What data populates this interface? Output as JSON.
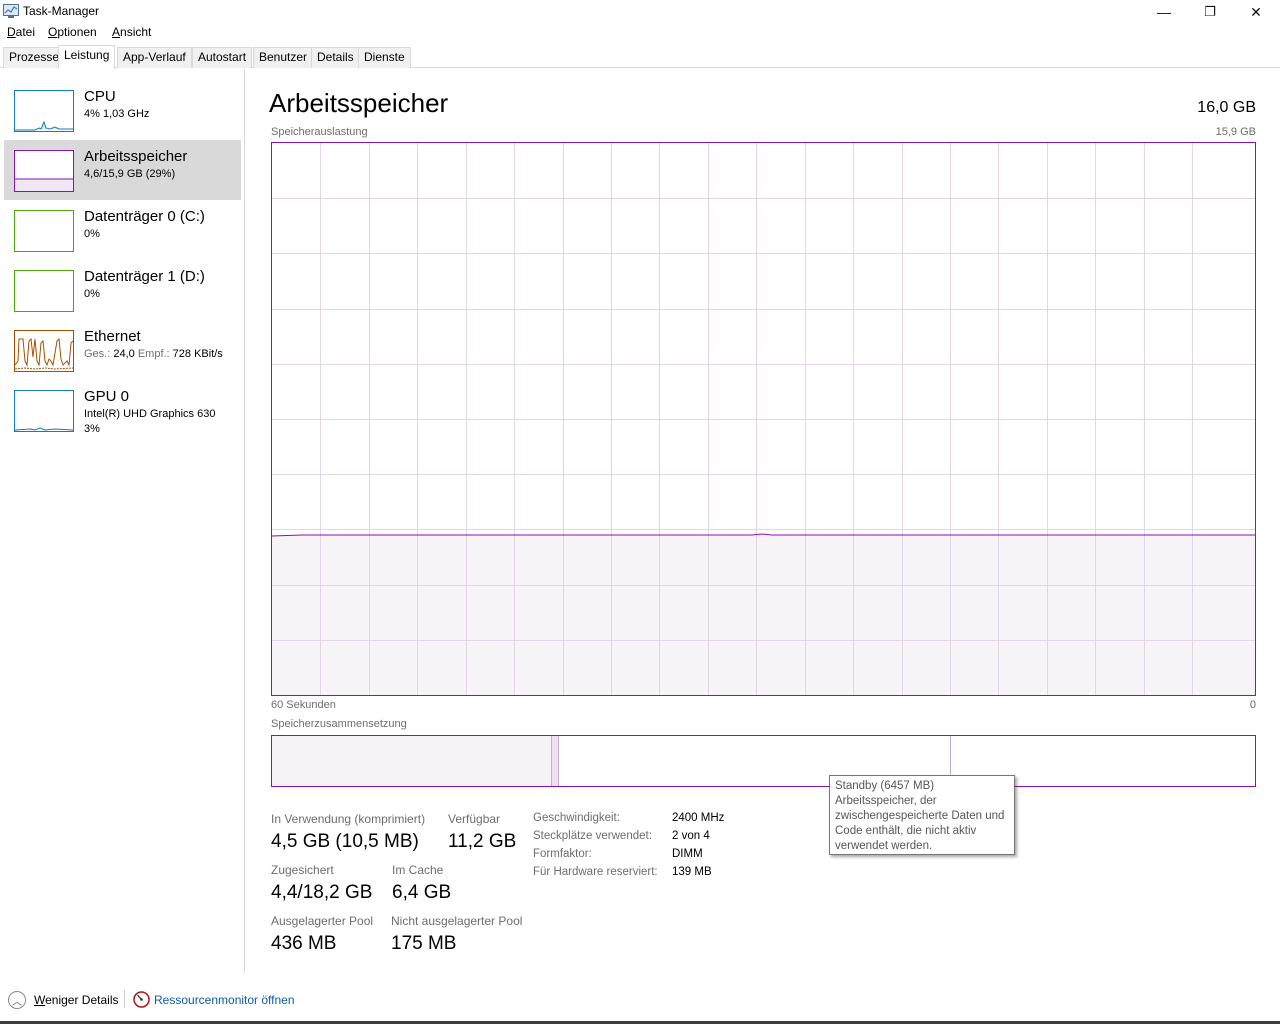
{
  "window": {
    "title": "Task-Manager",
    "minimize_glyph": "—",
    "restore_glyph": "❐",
    "close_glyph": "✕"
  },
  "menu": {
    "items": [
      {
        "accel": "D",
        "rest": "atei"
      },
      {
        "accel": "O",
        "rest": "ptionen"
      },
      {
        "accel": "A",
        "rest": "nsicht"
      }
    ]
  },
  "tabs": [
    "Prozesse",
    "Leistung",
    "App-Verlauf",
    "Autostart",
    "Benutzer",
    "Details",
    "Dienste"
  ],
  "active_tab": "Leistung",
  "sidebar": {
    "items": [
      {
        "name": "CPU",
        "sub": "4%  1,03 GHz",
        "color": "#117dbb",
        "icon": "cpu-graph"
      },
      {
        "name": "Arbeitsspeicher",
        "sub": "4,6/15,9 GB (29%)",
        "color": "#8b12ae",
        "icon": "memory-graph"
      },
      {
        "name": "Datenträger 0 (C:)",
        "sub": "0%",
        "color": "#4da60c",
        "icon": "disk-graph"
      },
      {
        "name": "Datenträger 1 (D:)",
        "sub": "0%",
        "color": "#4da60c",
        "icon": "disk-graph"
      },
      {
        "name": "Ethernet",
        "sub_label1": "Ges.: ",
        "sub_val1": "24,0",
        "sub_label2": " Empf.: ",
        "sub_val2": "728 KBit/s",
        "color": "#a74f01",
        "icon": "network-graph"
      },
      {
        "name": "GPU 0",
        "sub": "Intel(R) UHD Graphics 630",
        "sub2": "3%",
        "color": "#117dbb",
        "icon": "gpu-graph"
      }
    ]
  },
  "main": {
    "title": "Arbeitsspeicher",
    "total": "16,0 GB",
    "graph_label": "Speicherauslastung",
    "graph_max": "15,9 GB",
    "graph_time": "60 Sekunden",
    "graph_zero": "0",
    "usage_fraction": 0.29,
    "composition_label": "Speicherzusammensetzung",
    "stats": {
      "in_use_label": "In Verwendung (komprimiert)",
      "in_use_value": "4,5 GB (10,5 MB)",
      "available_label": "Verfügbar",
      "available_value": "11,2 GB",
      "committed_label": "Zugesichert",
      "committed_value": "4,4/18,2 GB",
      "cached_label": "Im Cache",
      "cached_value": "6,4 GB",
      "paged_label": "Ausgelagerter Pool",
      "paged_value": "436 MB",
      "nonpaged_label": "Nicht ausgelagerter Pool",
      "nonpaged_value": "175 MB"
    },
    "details": [
      {
        "key": "Geschwindigkeit:",
        "value": "2400 MHz"
      },
      {
        "key": "Steckplätze verwendet:",
        "value": "2 von 4"
      },
      {
        "key": "Formfaktor:",
        "value": "DIMM"
      },
      {
        "key": "Für Hardware reserviert:",
        "value": "139 MB"
      }
    ],
    "tooltip": "Standby (6457 MB)\nArbeitsspeicher, der zwischengespeicherte Daten und Code enthält, die nicht aktiv verwendet werden."
  },
  "footer": {
    "fewer_accel": "W",
    "fewer_rest": "eniger Details",
    "resmon": "Ressourcenmonitor öffnen"
  },
  "colors": {
    "memory": "#8b12ae",
    "memory_fill": "#f4f2f4",
    "grid": "#e2d6e6"
  }
}
